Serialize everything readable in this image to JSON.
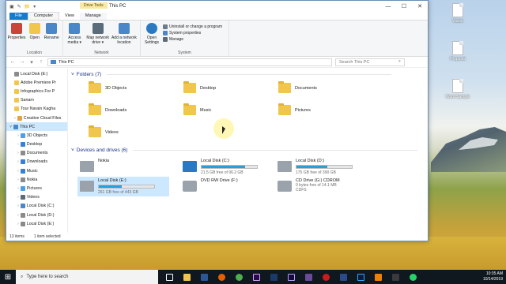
{
  "window": {
    "title": "This PC",
    "context_tab": "Drive Tools",
    "qa_glyphs": [
      "▣",
      "✎",
      "📁",
      "▾"
    ],
    "controls": {
      "minimize": "—",
      "maximize": "☐",
      "close": "✕"
    }
  },
  "ribbon_tabs": [
    "File",
    "Computer",
    "View",
    "Manage"
  ],
  "ribbon": {
    "location": {
      "label": "Location",
      "buttons": [
        {
          "label": "Properties",
          "icon": "properties-icon",
          "color": "#c9453a"
        },
        {
          "label": "Open",
          "icon": "open-icon",
          "color": "#f0c64c"
        },
        {
          "label": "Rename",
          "icon": "rename-icon",
          "color": "#4a87c9"
        }
      ]
    },
    "network": {
      "label": "Network",
      "buttons": [
        {
          "label": "Access media ▾",
          "icon": "media-icon",
          "color": "#4a87c9"
        },
        {
          "label": "Map network drive ▾",
          "icon": "map-drive-icon",
          "color": "#5a6b7a"
        },
        {
          "label": "Add a network location",
          "icon": "network-location-icon",
          "color": "#4a87c9"
        }
      ]
    },
    "system": {
      "label": "System",
      "open_settings": "Open Settings",
      "links": [
        "Uninstall or change a program",
        "System properties",
        "Manage"
      ]
    }
  },
  "address": {
    "path": "This PC",
    "search_placeholder": "Search This PC",
    "nav": [
      "←",
      "→",
      "▾",
      "↑"
    ]
  },
  "nav_pane": [
    {
      "label": "Local Disk (E:)",
      "type": "quick",
      "color": "#8a8a8a"
    },
    {
      "label": "Adobe Premiere Pr",
      "type": "quick",
      "color": "#f0c64c"
    },
    {
      "label": "Infographics For P",
      "type": "quick",
      "color": "#f0c64c"
    },
    {
      "label": "Sanam",
      "type": "quick",
      "color": "#f0c64c"
    },
    {
      "label": "Tour Narain Kagha",
      "type": "quick",
      "color": "#f0c64c"
    },
    {
      "label": "Creative Cloud Files",
      "type": "root",
      "color": "#e8a03a"
    },
    {
      "label": "This PC",
      "type": "pc",
      "color": "#4a87c9"
    },
    {
      "label": "3D Objects",
      "type": "child",
      "color": "#4aa0e6"
    },
    {
      "label": "Desktop",
      "type": "child",
      "color": "#3b7fd1"
    },
    {
      "label": "Documents",
      "type": "child",
      "color": "#8a8a8a"
    },
    {
      "label": "Downloads",
      "type": "child",
      "color": "#3b7fd1"
    },
    {
      "label": "Music",
      "type": "child",
      "color": "#3b7fd1"
    },
    {
      "label": "Nokia",
      "type": "child",
      "color": "#8a8a8a"
    },
    {
      "label": "Pictures",
      "type": "child",
      "color": "#4aa0e6"
    },
    {
      "label": "Videos",
      "type": "child",
      "color": "#5a6b7a"
    },
    {
      "label": "Local Disk (C:)",
      "type": "child",
      "color": "#4a87c9"
    },
    {
      "label": "Local Disk (D:)",
      "type": "child",
      "color": "#8a8a8a"
    },
    {
      "label": "Local Disk (E:)",
      "type": "child",
      "color": "#8a8a8a"
    }
  ],
  "folders": {
    "header": "Folders (7)",
    "items": [
      "3D Objects",
      "Desktop",
      "Documents",
      "Downloads",
      "Music",
      "Pictures",
      "Videos"
    ]
  },
  "devices": {
    "header": "Devices and drives (6)",
    "items": [
      {
        "name": "Nokia",
        "free": "",
        "fill": null
      },
      {
        "name": "Local Disk (C:)",
        "free": "21.5 GB free of 96.2 GB",
        "fill": 0.78
      },
      {
        "name": "Local Disk (D:)",
        "free": "175 GB free of 390 GB",
        "fill": 0.55
      },
      {
        "name": "Local Disk (E:)",
        "free": "261 GB free of 443 GB",
        "fill": 0.41
      },
      {
        "name": "DVD RW Drive (F:)",
        "free": "",
        "fill": null
      },
      {
        "name": "CD Drive (G:) CDROM",
        "free": "0 bytes free of 14.1 MB",
        "extra": "CDFS",
        "fill": null
      }
    ]
  },
  "status": {
    "items": "13 items",
    "selected": "1 item selected"
  },
  "desktop_icons": [
    "Vision",
    "Proposal",
    "Word Sample"
  ],
  "taskbar": {
    "search_placeholder": "Type here to search",
    "time": "10:35 AM",
    "date": "10/14/2019"
  }
}
